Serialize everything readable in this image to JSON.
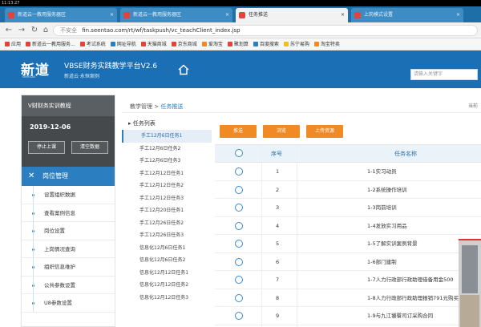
{
  "os": {
    "clock": "11:13:27"
  },
  "tabs": [
    {
      "label": "新道云一教用服务器区",
      "active": false
    },
    {
      "label": "新道云一教用服务器区",
      "active": false
    },
    {
      "label": "任务推送",
      "active": true
    },
    {
      "label": "上岗模式设置",
      "active": false
    }
  ],
  "address": {
    "insecure_label": "不安全",
    "url": "fin.seentao.com/rt/wf/taskpush/vc_teachClient_index.jsp"
  },
  "bookmarks": [
    {
      "label": "应用",
      "color": "#e0443b"
    },
    {
      "label": "新道云一教用服务...",
      "color": "#e0443b"
    },
    {
      "label": "考试系统",
      "color": "#e0443b"
    },
    {
      "label": "网址导航",
      "color": "#2b7fc0"
    },
    {
      "label": "天猫商城",
      "color": "#e0443b"
    },
    {
      "label": "京东商城",
      "color": "#e0443b"
    },
    {
      "label": "爱淘宝",
      "color": "#f08a24"
    },
    {
      "label": "聚划算",
      "color": "#e0443b"
    },
    {
      "label": "百度搜索",
      "color": "#2b7fc0"
    },
    {
      "label": "苏宁易购",
      "color": "#f0c020"
    },
    {
      "label": "淘宝特卖",
      "color": "#f08a24"
    }
  ],
  "app": {
    "logo": "新道",
    "logo_sub": "seentao",
    "title": "VBSE财务实践教学平台V2.6",
    "subtitle": "新道云·永恒案例",
    "search_placeholder": "请输入关键字"
  },
  "sidebar": {
    "header": "V财财务实训教程",
    "date": "2019-12-06",
    "btn_stop": "停止上课",
    "btn_clear": "清空数据",
    "menu_title": "岗位管理",
    "items": [
      {
        "label": "设置组织数据"
      },
      {
        "label": "查看案例信息"
      },
      {
        "label": "岗位设置"
      },
      {
        "label": "上岗情况查询"
      },
      {
        "label": "组织信息维护"
      },
      {
        "label": "公共参数设置"
      },
      {
        "label": "U8参数设置"
      }
    ]
  },
  "breadcrumb": {
    "root": "教学管理",
    "sep": " > ",
    "current": "任务推送",
    "right": "当前"
  },
  "tree": {
    "title": "任务列表",
    "items": [
      {
        "label": "手工12月6日任务1",
        "active": true
      },
      {
        "label": "手工12月6日任务2",
        "active": false
      },
      {
        "label": "手工12月6日任务3",
        "active": false
      },
      {
        "label": "手工12月12日任务1",
        "active": false
      },
      {
        "label": "手工12月12日任务2",
        "active": false
      },
      {
        "label": "手工12月12日任务3",
        "active": false
      },
      {
        "label": "手工12月20日任务1",
        "active": false
      },
      {
        "label": "手工12月26日任务2",
        "active": false
      },
      {
        "label": "手工12月26日任务3",
        "active": false
      },
      {
        "label": "信息化12月6日任务1",
        "active": false
      },
      {
        "label": "信息化12月6日任务2",
        "active": false
      },
      {
        "label": "信息化12月12日任务1",
        "active": false
      },
      {
        "label": "信息化12月12日任务2",
        "active": false
      },
      {
        "label": "信息化12月12日任务3",
        "active": false
      }
    ]
  },
  "actions": {
    "push": "推送",
    "browse": "浏览",
    "upload": "上传资源"
  },
  "table": {
    "col_seq": "序号",
    "col_name": "任务名称",
    "rows": [
      {
        "seq": "1",
        "name": "1-1实习动员"
      },
      {
        "seq": "2",
        "name": "1-2系统操作培训"
      },
      {
        "seq": "3",
        "name": "1-3岗前培训"
      },
      {
        "seq": "4",
        "name": "1-4发放实习用品"
      },
      {
        "seq": "5",
        "name": "1-5了解实训案例背景"
      },
      {
        "seq": "6",
        "name": "1-6部门建制"
      },
      {
        "seq": "7",
        "name": "1-7人力行政部行政助理借备用金500"
      },
      {
        "seq": "8",
        "name": "1-8人力行政部行政助理报销791元购买办"
      },
      {
        "seq": "9",
        "name": "1-9与九江饕餮司订采购合同"
      }
    ]
  }
}
